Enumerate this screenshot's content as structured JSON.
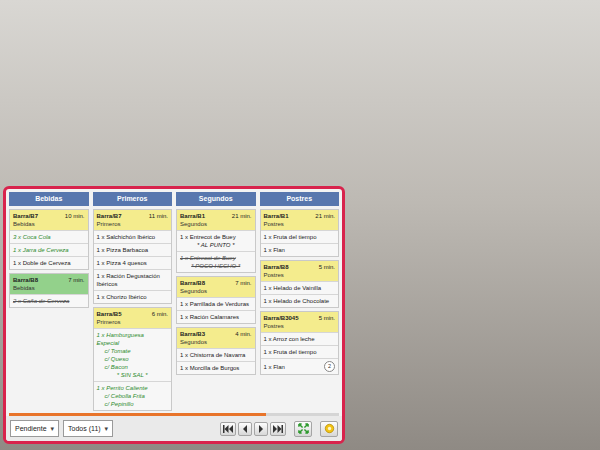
{
  "columns": [
    {
      "title": "Bebidas",
      "orders": [
        {
          "table": "Barra/B7",
          "time": "10 min.",
          "course": "Bebidas",
          "color": "#f4ec8d",
          "items": [
            {
              "text": "3 x Coca Cola",
              "kind": "done",
              "mods": []
            },
            {
              "text": "1 x Jarra de Cerveza",
              "kind": "done",
              "mods": []
            },
            {
              "text": "1 x Doble de Cerveza",
              "kind": "pending",
              "mods": []
            }
          ]
        },
        {
          "table": "Barra/B8",
          "time": "7 min.",
          "course": "Bebidas",
          "color": "#93d18b",
          "items": [
            {
              "text": "2 x Caña de Cerveza",
              "kind": "cancelled",
              "mods": []
            }
          ]
        }
      ]
    },
    {
      "title": "Primeros",
      "orders": [
        {
          "table": "Barra/B7",
          "time": "11 min.",
          "course": "Primeros",
          "color": "#f4ec8d",
          "items": [
            {
              "text": "1 x Salchichón Ibérico",
              "kind": "pending",
              "mods": []
            },
            {
              "text": "1 x Pizza Barbacoa",
              "kind": "pending",
              "mods": []
            },
            {
              "text": "1 x Pizza 4 quesos",
              "kind": "pending",
              "mods": []
            },
            {
              "text": "1 x Ración Degustación Ibéricos",
              "kind": "pending",
              "mods": []
            },
            {
              "text": "1 x Chorizo Ibérico",
              "kind": "pending",
              "mods": []
            }
          ]
        },
        {
          "table": "Barra/B5",
          "time": "6 min.",
          "course": "Primeros",
          "color": "#f4ec8d",
          "items": [
            {
              "text": "1 x Hamburguesa Especial",
              "kind": "done",
              "mods": [
                {
                  "text": "c/ Tomate",
                  "kind": "extra"
                },
                {
                  "text": "c/ Queso",
                  "kind": "extra"
                },
                {
                  "text": "c/ Bacon",
                  "kind": "extra"
                },
                {
                  "text": "* SIN SAL *",
                  "kind": "note"
                }
              ]
            },
            {
              "text": "1 x Perrito Caliente",
              "kind": "done",
              "mods": [
                {
                  "text": "c/ Cebolla Frita",
                  "kind": "extra"
                },
                {
                  "text": "c/ Pepinillo",
                  "kind": "extra"
                }
              ]
            }
          ]
        }
      ]
    },
    {
      "title": "Segundos",
      "orders": [
        {
          "table": "Barra/B1",
          "time": "21 min.",
          "course": "Segundos",
          "color": "#f4ec8d",
          "items": [
            {
              "text": "1 x Entrecot de Buey",
              "kind": "pending",
              "mods": [
                {
                  "text": "* AL PUNTO *",
                  "kind": "note"
                }
              ]
            },
            {
              "text": "1 x Entrecot de Buey",
              "kind": "cancelled",
              "mods": [
                {
                  "text": "* POCO HECHO *",
                  "kind": "note"
                }
              ]
            }
          ]
        },
        {
          "table": "Barra/B8",
          "time": "7 min.",
          "course": "Segundos",
          "color": "#f4ec8d",
          "items": [
            {
              "text": "1 x Parrillada de Verduras",
              "kind": "pending",
              "mods": []
            },
            {
              "text": "1 x Ración Calamares",
              "kind": "pending",
              "mods": []
            }
          ]
        },
        {
          "table": "Barra/B3",
          "time": "4 min.",
          "course": "Segundos",
          "color": "#f4ec8d",
          "items": [
            {
              "text": "1 x Chistorra de Navarra",
              "kind": "pending",
              "mods": []
            },
            {
              "text": "1 x Morcilla de Burgos",
              "kind": "pending",
              "mods": []
            }
          ]
        }
      ]
    },
    {
      "title": "Postres",
      "orders": [
        {
          "table": "Barra/B1",
          "time": "21 min.",
          "course": "Postres",
          "color": "#f4ec8d",
          "items": [
            {
              "text": "1 x Fruta del tiempo",
              "kind": "pending",
              "mods": []
            },
            {
              "text": "1 x Flan",
              "kind": "pending",
              "mods": []
            }
          ]
        },
        {
          "table": "Barra/B8",
          "time": "5 min.",
          "course": "Postres",
          "color": "#f4ec8d",
          "items": [
            {
              "text": "1 x Helado de Vainilla",
              "kind": "pending",
              "mods": []
            },
            {
              "text": "1 x Helado de Chocolate",
              "kind": "pending",
              "mods": []
            }
          ]
        },
        {
          "table": "Barra/B3045",
          "time": "5 min.",
          "course": "Postres",
          "color": "#f4ec8d",
          "items": [
            {
              "text": "1 x Arroz con leche",
              "kind": "pending",
              "mods": []
            },
            {
              "text": "1 x Fruta del tiempo",
              "kind": "pending",
              "mods": []
            },
            {
              "text": "1 x Flan",
              "kind": "pending",
              "mods": [],
              "badge": "2"
            }
          ]
        }
      ]
    }
  ],
  "progress": {
    "level": 0.78
  },
  "toolbar": {
    "status_filter": {
      "label": "Pendiente",
      "arrow": "▾"
    },
    "count_filter": {
      "label": "Todos (11)",
      "arrow": "▾"
    }
  }
}
